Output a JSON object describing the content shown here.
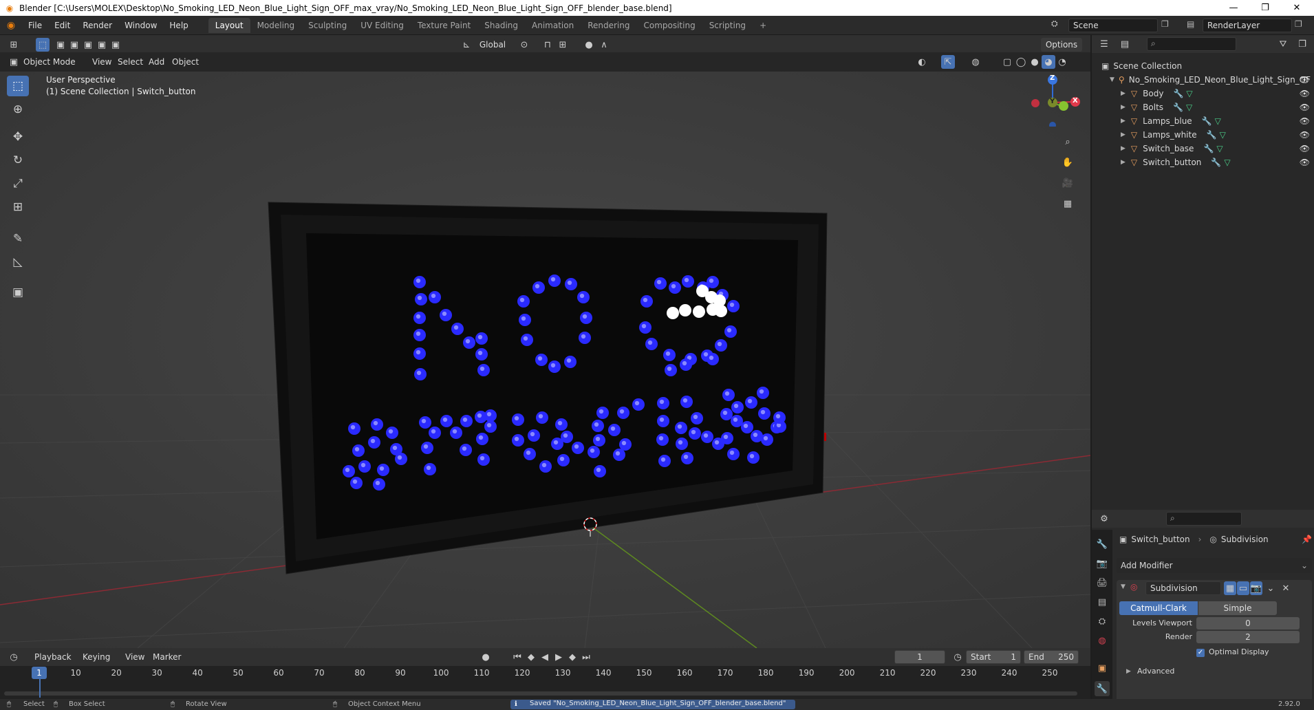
{
  "window": {
    "title": "Blender [C:\\Users\\MOLEX\\Desktop\\No_Smoking_LED_Neon_Blue_Light_Sign_OFF_max_vray/No_Smoking_LED_Neon_Blue_Light_Sign_OFF_blender_base.blend]",
    "minimize": "—",
    "maximize": "❐",
    "close": "✕"
  },
  "menu": [
    "File",
    "Edit",
    "Render",
    "Window",
    "Help"
  ],
  "workspaces": [
    "Layout",
    "Modeling",
    "Sculpting",
    "UV Editing",
    "Texture Paint",
    "Shading",
    "Animation",
    "Rendering",
    "Compositing",
    "Scripting"
  ],
  "active_workspace": "Layout",
  "add_workspace": "+",
  "scene": {
    "label": "Scene",
    "render_layer": "RenderLayer"
  },
  "viewport": {
    "mode": "Object Mode",
    "menus": [
      "View",
      "Select",
      "Add",
      "Object"
    ],
    "transform_orientation": "Global",
    "options": "Options",
    "info_line1": "User Perspective",
    "info_line2": "(1) Scene Collection | Switch_button",
    "gizmo": {
      "z": "Z",
      "y": "Y",
      "x": "X"
    }
  },
  "outliner": {
    "root": "Scene Collection",
    "collection": "No_Smoking_LED_Neon_Blue_Light_Sign_OF",
    "objects": [
      "Body",
      "Bolts",
      "Lamps_blue",
      "Lamps_white",
      "Switch_base",
      "Switch_button"
    ]
  },
  "properties": {
    "object": "Switch_button",
    "modifier_context": "Subdivision",
    "add_modifier": "Add Modifier",
    "modifier": {
      "name": "Subdivision",
      "tab_catmull": "Catmull-Clark",
      "tab_simple": "Simple",
      "levels_label": "Levels Viewport",
      "levels_value": "0",
      "render_label": "Render",
      "render_value": "2",
      "optimal_display": "Optimal Display",
      "optimal_checked": true,
      "advanced": "Advanced"
    }
  },
  "timeline": {
    "menus": [
      "Playback",
      "Keying",
      "View",
      "Marker"
    ],
    "current_frame": "1",
    "start_label": "Start",
    "start": "1",
    "end_label": "End",
    "end": "250",
    "ticks": [
      "1",
      "10",
      "20",
      "30",
      "40",
      "50",
      "60",
      "70",
      "80",
      "90",
      "100",
      "110",
      "120",
      "130",
      "140",
      "150",
      "160",
      "170",
      "180",
      "190",
      "200",
      "210",
      "220",
      "230",
      "240",
      "250"
    ]
  },
  "statusbar": {
    "select": "Select",
    "box_select": "Box Select",
    "rotate_view": "Rotate View",
    "context_menu": "Object Context Menu",
    "message": "Saved \"No_Smoking_LED_Neon_Blue_Light_Sign_OFF_blender_base.blend\"",
    "version": "2.92.0"
  },
  "colors": {
    "accent": "#4772b3",
    "led_blue": "#2a2aff",
    "led_white": "#ffffff",
    "x_axis": "#c8303a",
    "y_axis": "#6a9a2a"
  }
}
